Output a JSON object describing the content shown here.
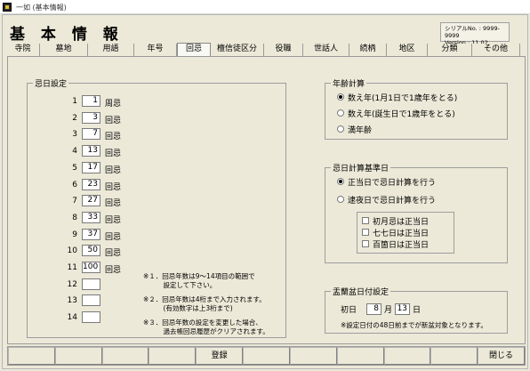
{
  "window": {
    "title": "一如 (基本情報)"
  },
  "page": {
    "title": "基 本 情 報"
  },
  "serial": {
    "line1": "シリアルNo. : 9999-9999",
    "line2": "Version : 11.02"
  },
  "tabs": [
    "寺院",
    "墓地",
    "用語",
    "年号",
    "回忌",
    "檀信徒区分",
    "役職",
    "世話人",
    "続柄",
    "地区",
    "分類",
    "その他"
  ],
  "memorial": {
    "legend": "忌日設定",
    "rows": [
      {
        "num": "1",
        "value": "1",
        "name": "周忌"
      },
      {
        "num": "2",
        "value": "3",
        "name": "回忌"
      },
      {
        "num": "3",
        "value": "7",
        "name": "回忌"
      },
      {
        "num": "4",
        "value": "13",
        "name": "回忌"
      },
      {
        "num": "5",
        "value": "17",
        "name": "回忌"
      },
      {
        "num": "6",
        "value": "23",
        "name": "回忌"
      },
      {
        "num": "7",
        "value": "27",
        "name": "回忌"
      },
      {
        "num": "8",
        "value": "33",
        "name": "回忌"
      },
      {
        "num": "9",
        "value": "37",
        "name": "回忌"
      },
      {
        "num": "10",
        "value": "50",
        "name": "回忌"
      },
      {
        "num": "11",
        "value": "100",
        "name": "回忌"
      },
      {
        "num": "12",
        "value": "",
        "name": ""
      },
      {
        "num": "13",
        "value": "",
        "name": ""
      },
      {
        "num": "14",
        "value": "",
        "name": ""
      }
    ],
    "notes": [
      "※１．回忌年数は9～14項目の範囲で\n　　　設定して下さい。",
      "※２．回忌年数は4桁まで入力されます。\n　　　(有効数字は上3桁まで)",
      "※３．回忌年数の設定を変更した場合、\n　　　過去帳回忌履歴がクリアされます。"
    ]
  },
  "age": {
    "legend": "年齢計算",
    "options": [
      "数え年(1月1日で1歳年をとる)",
      "数え年(誕生日で1歳年をとる)",
      "満年齢"
    ],
    "selected": 0
  },
  "deathcalc": {
    "legend": "忌日計算基準日",
    "options": [
      "正当日で忌日計算を行う",
      "逮夜日で忌日計算を行う"
    ],
    "selected": 0,
    "checks": [
      "初月忌は正当日",
      "七七日は正当日",
      "百箇日は正当日"
    ]
  },
  "obon": {
    "legend": "盂蘭盆日付設定",
    "label": "初日",
    "month": "8",
    "month_unit": "月",
    "day": "13",
    "day_unit": "日",
    "note": "※設定日付の48日前までが新盆対象となります。"
  },
  "bottom": {
    "buttons": [
      "",
      "",
      "",
      "",
      "登録",
      "",
      "",
      "",
      "",
      "",
      "閉じる"
    ]
  }
}
